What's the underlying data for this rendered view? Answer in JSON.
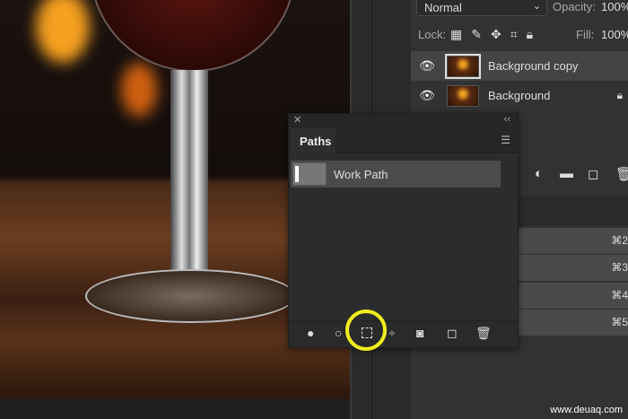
{
  "layers_panel": {
    "blend_mode": "Normal",
    "opacity_label": "Opacity:",
    "opacity": "100%",
    "lock_label": "Lock:",
    "fill_label": "Fill:",
    "fill": "100%",
    "layers": [
      {
        "name": "Background copy",
        "selected": true,
        "locked": false
      },
      {
        "name": "Background",
        "selected": false,
        "locked": true
      }
    ]
  },
  "channels": {
    "shortcuts": [
      "⌘2",
      "⌘3",
      "⌘4",
      "⌘5"
    ]
  },
  "paths_panel": {
    "title": "Paths",
    "items": [
      {
        "name": "Work Path"
      }
    ],
    "footer_buttons": [
      "fill-path",
      "stroke-path",
      "load-path-as-selection",
      "make-work-path",
      "add-mask",
      "create-new-path",
      "delete-path"
    ]
  },
  "highlight": {
    "target": "load-path-as-selection",
    "color": "#f2ee1e"
  },
  "watermark": "www.deuaq.com"
}
